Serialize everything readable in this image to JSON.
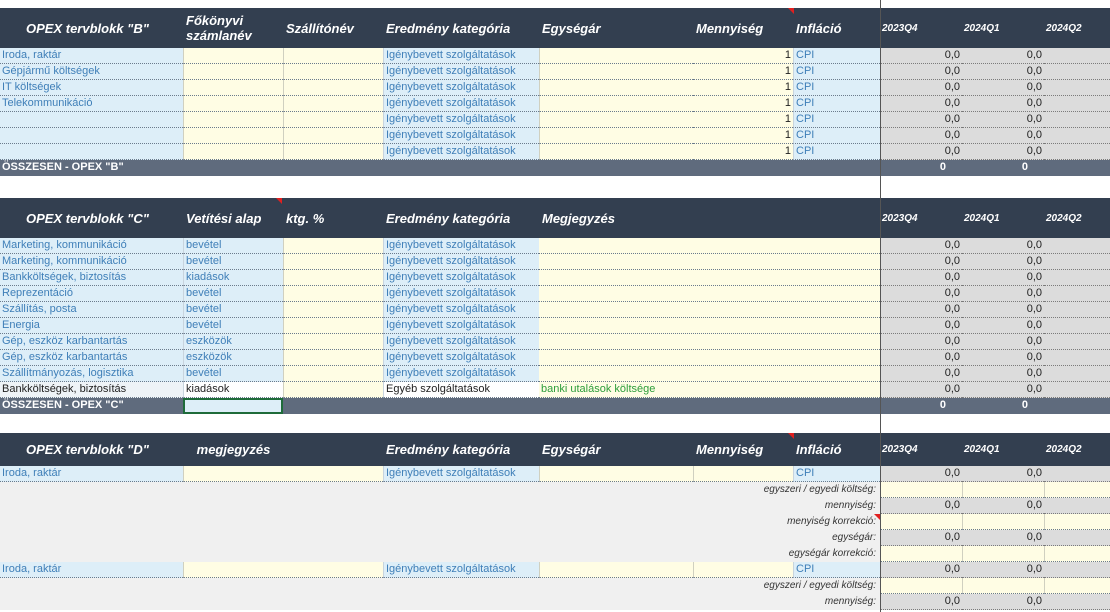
{
  "blockB": {
    "headers": [
      "OPEX tervblokk \"B\"",
      "Főkönyvi számlanév",
      "Szállítónév",
      "Eredmény kategória",
      "Egységár",
      "Mennyiség",
      "Infláció"
    ],
    "periods": [
      [
        "2023",
        "Q4"
      ],
      [
        "2024",
        "Q1"
      ],
      [
        "2024",
        "Q2"
      ]
    ],
    "rows": [
      {
        "name": "Iroda, raktár",
        "cat": "Igénybevett szolgáltatások",
        "qty": "1",
        "infl": "CPI",
        "v1": "0,0",
        "v2": "0,0"
      },
      {
        "name": "Gépjármű költségek",
        "cat": "Igénybevett szolgáltatások",
        "qty": "1",
        "infl": "CPI",
        "v1": "0,0",
        "v2": "0,0"
      },
      {
        "name": "IT költségek",
        "cat": "Igénybevett szolgáltatások",
        "qty": "1",
        "infl": "CPI",
        "v1": "0,0",
        "v2": "0,0"
      },
      {
        "name": "Telekommunikáció",
        "cat": "Igénybevett szolgáltatások",
        "qty": "1",
        "infl": "CPI",
        "v1": "0,0",
        "v2": "0,0"
      },
      {
        "name": "",
        "cat": "Igénybevett szolgáltatások",
        "qty": "1",
        "infl": "CPI",
        "v1": "0,0",
        "v2": "0,0"
      },
      {
        "name": "",
        "cat": "Igénybevett szolgáltatások",
        "qty": "1",
        "infl": "CPI",
        "v1": "0,0",
        "v2": "0,0"
      },
      {
        "name": "",
        "cat": "Igénybevett szolgáltatások",
        "qty": "1",
        "infl": "CPI",
        "v1": "0,0",
        "v2": "0,0"
      }
    ],
    "total": {
      "label": "ÖSSZESEN - OPEX \"B\"",
      "v1": "0",
      "v2": "0"
    }
  },
  "blockC": {
    "headers": [
      "OPEX tervblokk \"C\"",
      "Vetítési alap",
      "ktg. %",
      "Eredmény kategória",
      "Megjegyzés"
    ],
    "periods": [
      [
        "2023",
        "Q4"
      ],
      [
        "2024",
        "Q1"
      ],
      [
        "2024",
        "Q2"
      ]
    ],
    "rows": [
      {
        "name": "Marketing, kommunikáció",
        "base": "bevétel",
        "cat": "Igénybevett szolgáltatások",
        "note": "",
        "v1": "0,0",
        "v2": "0,0"
      },
      {
        "name": "Marketing, kommunikáció",
        "base": "bevétel",
        "cat": "Igénybevett szolgáltatások",
        "note": "",
        "v1": "0,0",
        "v2": "0,0"
      },
      {
        "name": "Bankköltségek, biztosítás",
        "base": "kiadások",
        "cat": "Igénybevett szolgáltatások",
        "note": "",
        "v1": "0,0",
        "v2": "0,0"
      },
      {
        "name": "Reprezentáció",
        "base": "bevétel",
        "cat": "Igénybevett szolgáltatások",
        "note": "",
        "v1": "0,0",
        "v2": "0,0"
      },
      {
        "name": "Szállítás, posta",
        "base": "bevétel",
        "cat": "Igénybevett szolgáltatások",
        "note": "",
        "v1": "0,0",
        "v2": "0,0"
      },
      {
        "name": "Energia",
        "base": "bevétel",
        "cat": "Igénybevett szolgáltatások",
        "note": "",
        "v1": "0,0",
        "v2": "0,0"
      },
      {
        "name": "Gép, eszköz karbantartás",
        "base": "eszközök",
        "cat": "Igénybevett szolgáltatások",
        "note": "",
        "v1": "0,0",
        "v2": "0,0"
      },
      {
        "name": "Gép, eszköz karbantartás",
        "base": "eszközök",
        "cat": "Igénybevett szolgáltatások",
        "note": "",
        "v1": "0,0",
        "v2": "0,0"
      },
      {
        "name": "Szállítmányozás, logisztika",
        "base": "bevétel",
        "cat": "Igénybevett szolgáltatások",
        "note": "",
        "v1": "0,0",
        "v2": "0,0"
      },
      {
        "name": "Bankköltségek, biztosítás",
        "base": "kiadások",
        "cat": "Egyéb szolgáltatások",
        "note": "banki utalások költsége",
        "v1": "0,0",
        "v2": "0,0",
        "plain": true
      }
    ],
    "total": {
      "label": "ÖSSZESEN - OPEX \"C\"",
      "v1": "0",
      "v2": "0"
    }
  },
  "blockD": {
    "headers": [
      "OPEX tervblokk \"D\"",
      "megjegyzés",
      "Eredmény kategória",
      "Egységár",
      "Mennyiség",
      "Infláció"
    ],
    "periods": [
      [
        "2023",
        "Q4"
      ],
      [
        "2024",
        "Q1"
      ],
      [
        "2024",
        "Q2"
      ]
    ],
    "item1": {
      "name": "Iroda, raktár",
      "cat": "Igénybevett szolgáltatások",
      "infl": "CPI",
      "v1": "0,0",
      "v2": "0,0"
    },
    "item2": {
      "name": "Iroda, raktár",
      "cat": "Igénybevett szolgáltatások",
      "infl": "CPI",
      "v1": "0,0",
      "v2": "0,0"
    },
    "sublabels": [
      "egyszeri / egyedi költség:",
      "mennyiség:",
      "menyiség korrekció:",
      "egységár:",
      "egységár korrekció:"
    ],
    "subvalues": {
      "qty_v1": "0,0",
      "qty_v2": "0,0",
      "price_v1": "0,0",
      "price_v2": "0,0"
    }
  }
}
